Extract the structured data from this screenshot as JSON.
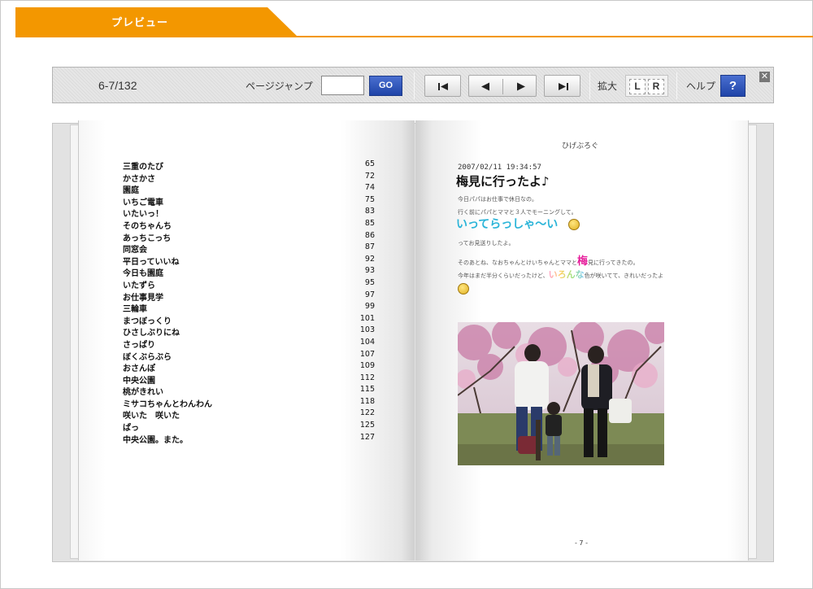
{
  "header": {
    "title": "プレビュー",
    "accent_color": "#f39700"
  },
  "toolbar": {
    "page_counter": "6-7/132",
    "jump_label": "ページジャンプ",
    "jump_value": "",
    "go_label": "GO",
    "first_icon": "first-page-icon",
    "prev_icon": "prev-page-icon",
    "next_icon": "next-page-icon",
    "last_icon": "last-page-icon",
    "zoom_label": "拡大",
    "zoom_left": "L",
    "zoom_right": "R",
    "help_label": "ヘルプ",
    "help_button": "?",
    "close_icon": "close-icon",
    "close_glyph": "✕"
  },
  "left_page": {
    "toc": [
      {
        "title": "三重のたび",
        "page": "65"
      },
      {
        "title": "かさかさ",
        "page": "72"
      },
      {
        "title": "園庭",
        "page": "74"
      },
      {
        "title": "いちご電車",
        "page": "75"
      },
      {
        "title": "いたいっ！",
        "page": "83"
      },
      {
        "title": "そのちゃんち",
        "page": "85"
      },
      {
        "title": "あっちこっち",
        "page": "86"
      },
      {
        "title": "同窓会",
        "page": "87"
      },
      {
        "title": "平日っていいね",
        "page": "92"
      },
      {
        "title": "今日も園庭",
        "page": "93"
      },
      {
        "title": "いたずら",
        "page": "95"
      },
      {
        "title": "お仕事見学",
        "page": "97"
      },
      {
        "title": "三輪車",
        "page": "99"
      },
      {
        "title": "まつぼっくり",
        "page": "101"
      },
      {
        "title": "ひさしぶりにね",
        "page": "103"
      },
      {
        "title": "さっぱり",
        "page": "104"
      },
      {
        "title": "ぼくぶらぶら",
        "page": "107"
      },
      {
        "title": "おさんぽ",
        "page": "109"
      },
      {
        "title": "中央公園",
        "page": "112"
      },
      {
        "title": "桃がきれい",
        "page": "115"
      },
      {
        "title": "ミサコちゃんとわんわん",
        "page": "118"
      },
      {
        "title": "咲いた　咲いた",
        "page": "122"
      },
      {
        "title": "ぱっ",
        "page": "125"
      },
      {
        "title": "中央公園。また。",
        "page": "127"
      }
    ]
  },
  "right_page": {
    "blog_name": "ひげぶろぐ",
    "post_date": "2007/02/11 19:34:57",
    "post_title": "梅見に行ったよ♪",
    "line1": "今日パパはお仕事で休日なの。",
    "line2": "行く前にパパとママと３人でモーニングして。",
    "big_text": "いってらっしゃ〜い",
    "line3": "ってお見送りしたよ。",
    "line4a": "そのあとね、なおちゃんとけいちゃんとママと",
    "line4_big": "梅",
    "line4b": "見に行ってきたの。",
    "line5a": "今年はまだ半分くらいだったけど、",
    "line5_color": "いろんな",
    "line5b": "色が咲いてて、きれいだったよ",
    "page_number": "- 7 -"
  }
}
